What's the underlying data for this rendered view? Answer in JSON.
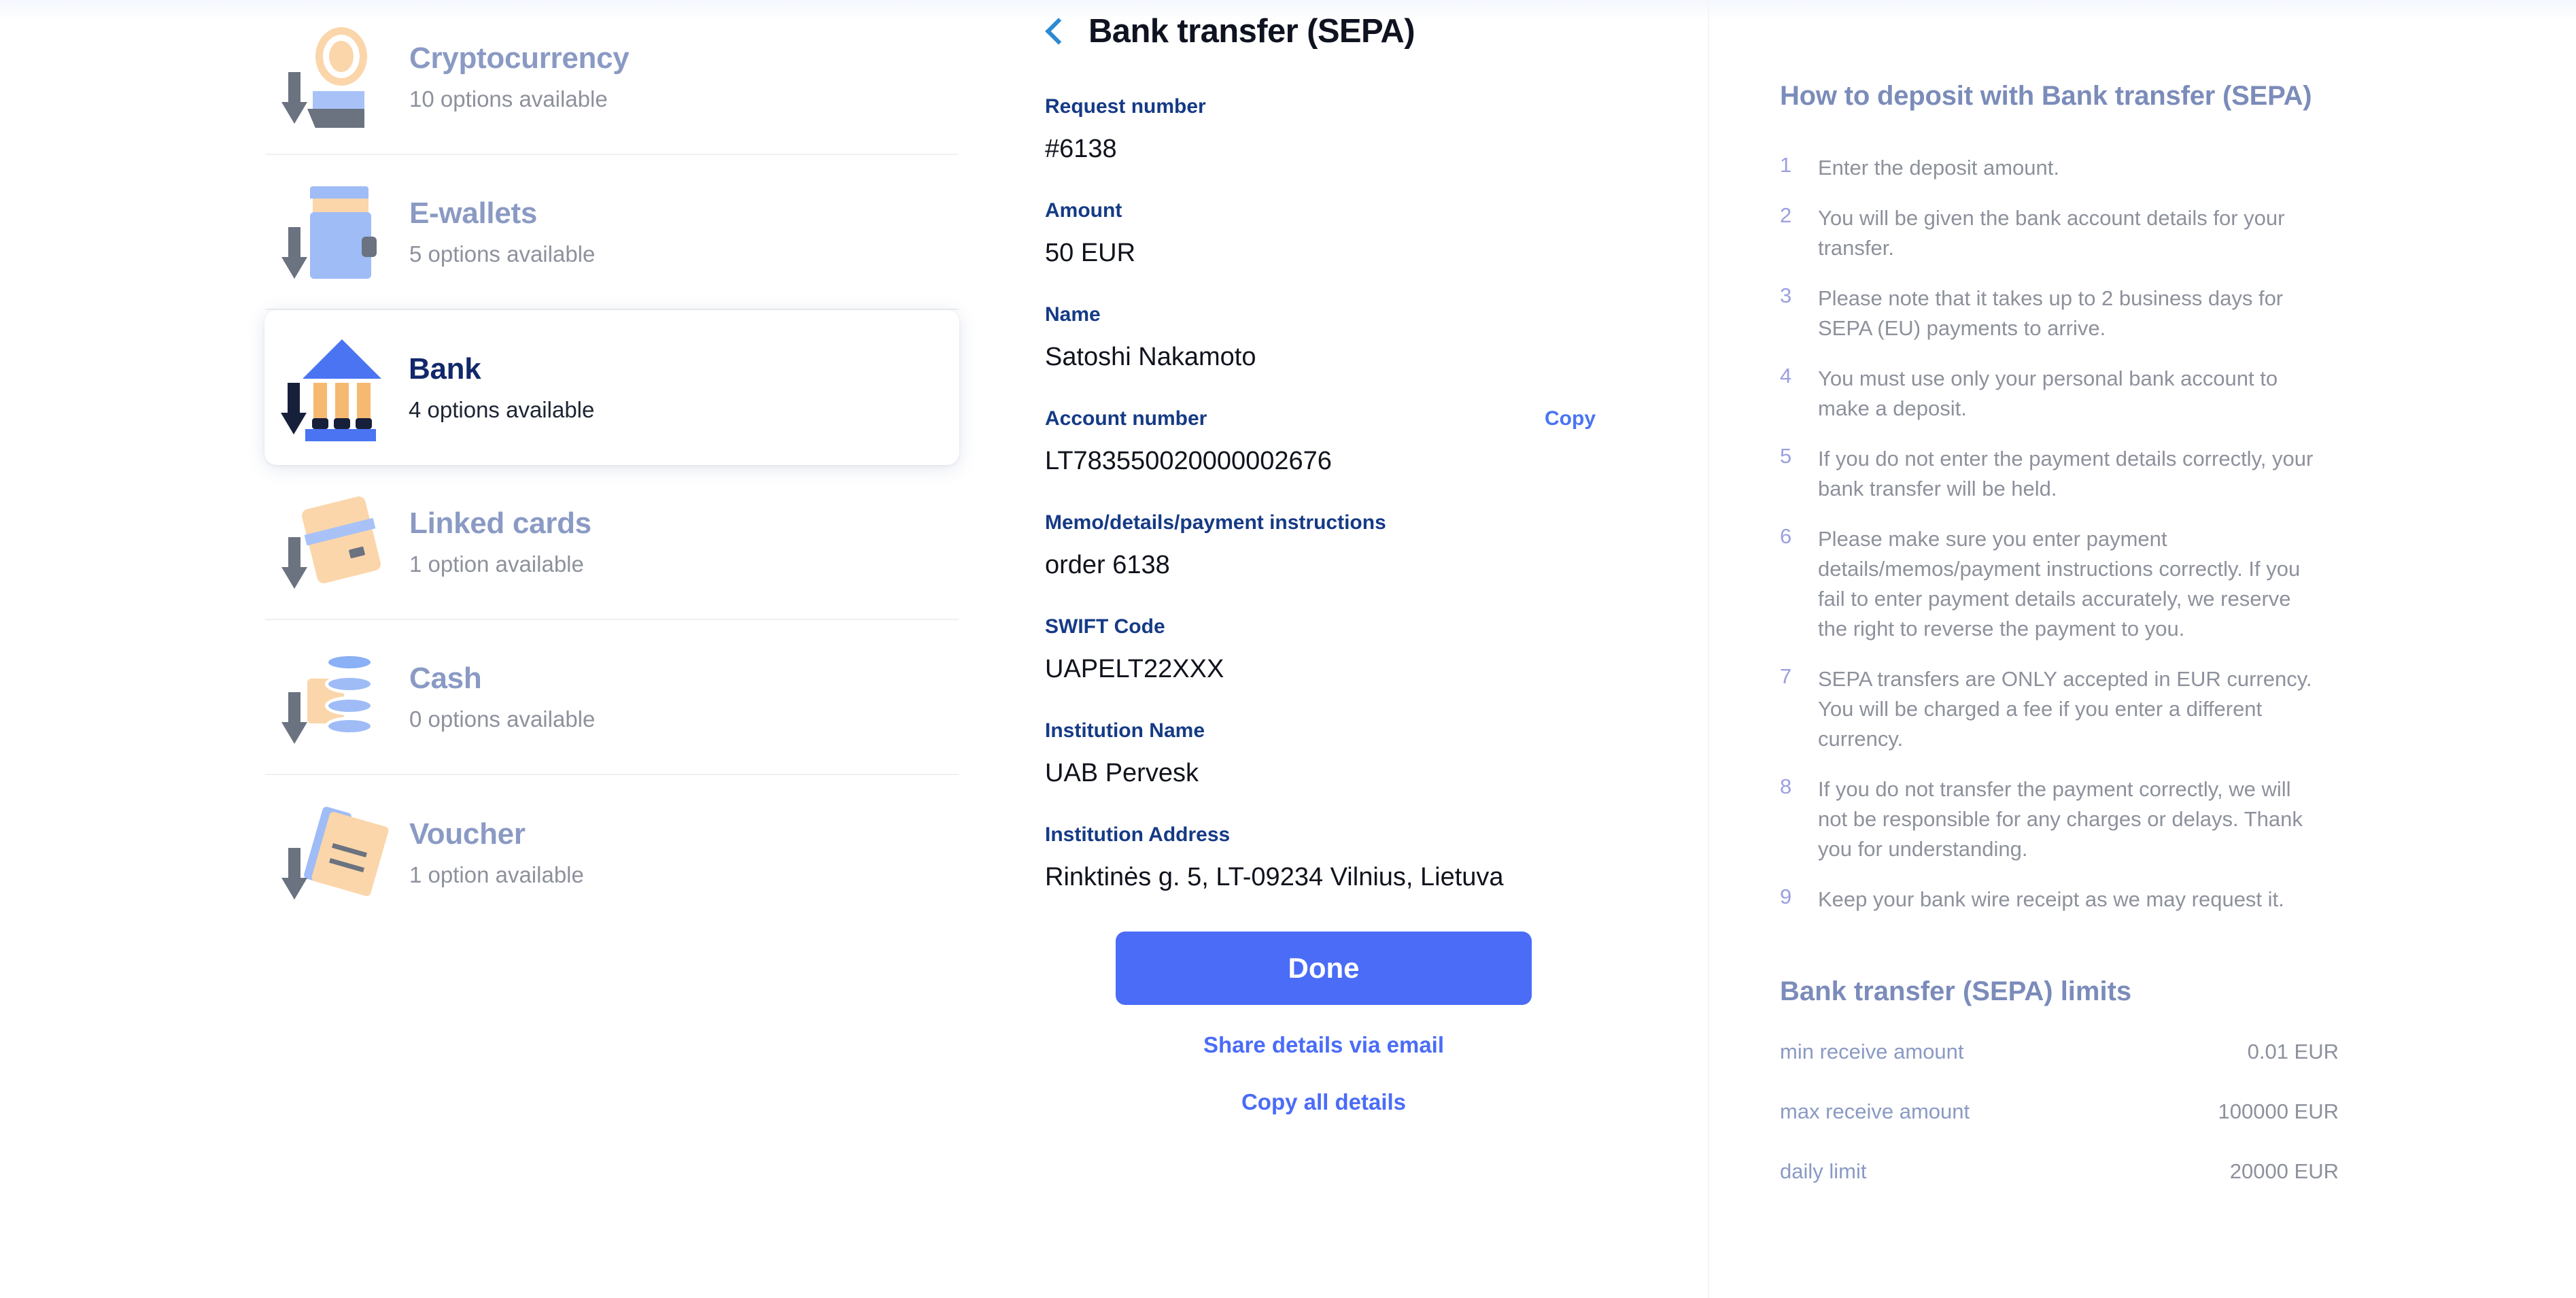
{
  "sidebar": {
    "items": [
      {
        "id": "cryptocurrency",
        "label": "Cryptocurrency",
        "sub": "10 options available",
        "icon": "cryptocurrency-deposit-icon",
        "selected": false
      },
      {
        "id": "e-wallets",
        "label": "E-wallets",
        "sub": "5 options available",
        "icon": "wallet-deposit-icon",
        "selected": false
      },
      {
        "id": "bank",
        "label": "Bank",
        "sub": "4 options available",
        "icon": "bank-deposit-icon",
        "selected": true
      },
      {
        "id": "linked-cards",
        "label": "Linked cards",
        "sub": "1 option available",
        "icon": "card-deposit-icon",
        "selected": false
      },
      {
        "id": "cash",
        "label": "Cash",
        "sub": "0 options available",
        "icon": "cash-deposit-icon",
        "selected": false
      },
      {
        "id": "voucher",
        "label": "Voucher",
        "sub": "1 option available",
        "icon": "voucher-deposit-icon",
        "selected": false
      }
    ]
  },
  "detail": {
    "back_icon": "chevron-left-icon",
    "title": "Bank transfer (SEPA)",
    "fields": [
      {
        "id": "request-number",
        "label": "Request number",
        "value": "#6138",
        "copy": null
      },
      {
        "id": "amount",
        "label": "Amount",
        "value": "50 EUR",
        "copy": null
      },
      {
        "id": "name",
        "label": "Name",
        "value": "Satoshi Nakamoto",
        "copy": null
      },
      {
        "id": "account-number",
        "label": "Account number",
        "value": "LT783550020000002676",
        "copy": "Copy"
      },
      {
        "id": "memo",
        "label": "Memo/details/payment instructions",
        "value": "order 6138",
        "copy": null
      },
      {
        "id": "swift-code",
        "label": "SWIFT Code",
        "value": "UAPELT22XXX",
        "copy": null
      },
      {
        "id": "institution-name",
        "label": "Institution Name",
        "value": "UAB Pervesk",
        "copy": null
      },
      {
        "id": "institution-addr",
        "label": "Institution Address",
        "value": "Rinktinės g. 5, LT-09234 Vilnius, Lietuva",
        "copy": null
      }
    ],
    "done_label": "Done",
    "share_label": "Share details via email",
    "copy_all_label": "Copy all details"
  },
  "info": {
    "how_to_title": "How to deposit with Bank transfer (SEPA)",
    "steps": [
      {
        "n": "1",
        "text": "Enter the deposit amount."
      },
      {
        "n": "2",
        "text": "You will be given the bank account details for your transfer."
      },
      {
        "n": "3",
        "text": "Please note that it takes up to 2 business days for SEPA (EU) payments to arrive."
      },
      {
        "n": "4",
        "text": "You must use only your personal bank account to make a deposit."
      },
      {
        "n": "5",
        "text": "If you do not enter the payment details correctly, your bank transfer will be held."
      },
      {
        "n": "6",
        "text": "Please make sure you enter payment details/memos/payment instructions correctly. If you fail to enter payment details accurately, we reserve the right to reverse the payment to you."
      },
      {
        "n": "7",
        "text": "SEPA transfers are ONLY accepted in EUR currency. You will be charged a fee if you enter a different currency."
      },
      {
        "n": "8",
        "text": "If you do not transfer the payment correctly, we will not be responsible for any charges or delays. Thank you for understanding."
      },
      {
        "n": "9",
        "text": "Keep your bank wire receipt as we may request it."
      }
    ],
    "limits_title": "Bank transfer (SEPA) limits",
    "limits": [
      {
        "key": "min receive amount",
        "value": "0.01 EUR"
      },
      {
        "key": "max receive amount",
        "value": "100000 EUR"
      },
      {
        "key": "daily limit",
        "value": "20000 EUR"
      }
    ]
  },
  "colors": {
    "accent_blue": "#4a6cf7",
    "link_blue": "#4a74f2",
    "label_navy": "#153a86",
    "muted_blue": "#8a9ac4",
    "back_chevron": "#2c8ad4"
  }
}
